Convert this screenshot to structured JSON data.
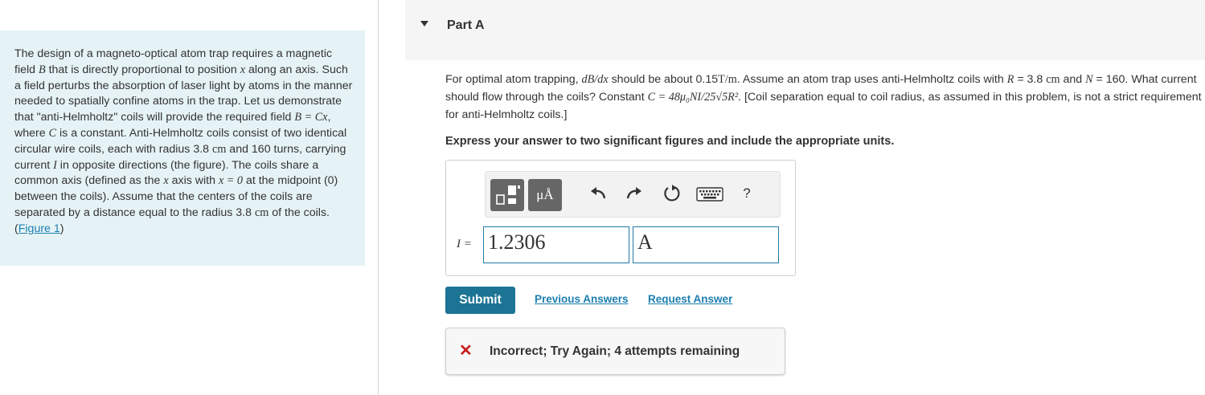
{
  "problem": {
    "t1": "The design of a magneto-optical atom trap requires a magnetic field ",
    "B": "B",
    "t2": " that is directly proportional to position ",
    "x": "x",
    "t3": " along an axis. Such a field perturbs the absorption of laser light by atoms in the manner needed to spatially confine atoms in the trap. Let us demonstrate that \"anti-Helmholtz\" coils will provide the required field ",
    "eq_field": "B = Cx",
    "t4": ", where ",
    "C": "C",
    "t5": " is a constant. Anti-Helmholtz coils consist of two identical circular wire coils, each with radius 3.8 ",
    "cm1": "cm",
    "t6": " and 160 turns, carrying current ",
    "I": "I",
    "t7": " in opposite directions (the figure). The coils share a common axis (defined as the ",
    "x2": "x",
    "t8": " axis with ",
    "eq_x0": "x = 0",
    "t9": " at the midpoint (0) between the coils). Assume that the centers of the coils are separated by a distance equal to the radius 3.8 ",
    "cm2": "cm",
    "t10": " of the coils. (",
    "figure_link": "Figure 1",
    "t11": ")"
  },
  "part": {
    "title": "Part A"
  },
  "question": {
    "q1": "For optimal atom trapping, ",
    "dBdx": "dB/dx",
    "q2": " should be about 0.15",
    "unit_Tm": "T/m",
    "q3": ". Assume an atom trap uses anti-Helmholtz coils with ",
    "R": "R",
    "q4": " = 3.8 ",
    "cm": "cm",
    "q5": " and ",
    "N": "N",
    "q6": " = 160. What current should flow through the coils? Constant ",
    "C": "C",
    "eq": " = 48μ₀NI/25√5R²",
    "q7": ". [Coil separation equal to coil radius, as assumed in this problem, is not a strict requirement for anti-Helmholtz coils.]"
  },
  "instruction": "Express your answer to two significant figures and include the appropriate units.",
  "answer": {
    "var_label": "I =",
    "value": "1.2306",
    "unit": "A",
    "units_button": "μÅ",
    "help": "?"
  },
  "actions": {
    "submit": "Submit",
    "previous_answers": "Previous Answers",
    "request_answer": "Request Answer"
  },
  "feedback": {
    "icon": "x-mark",
    "text": "Incorrect; Try Again; 4 attempts remaining",
    "color": "#c81e1e"
  }
}
